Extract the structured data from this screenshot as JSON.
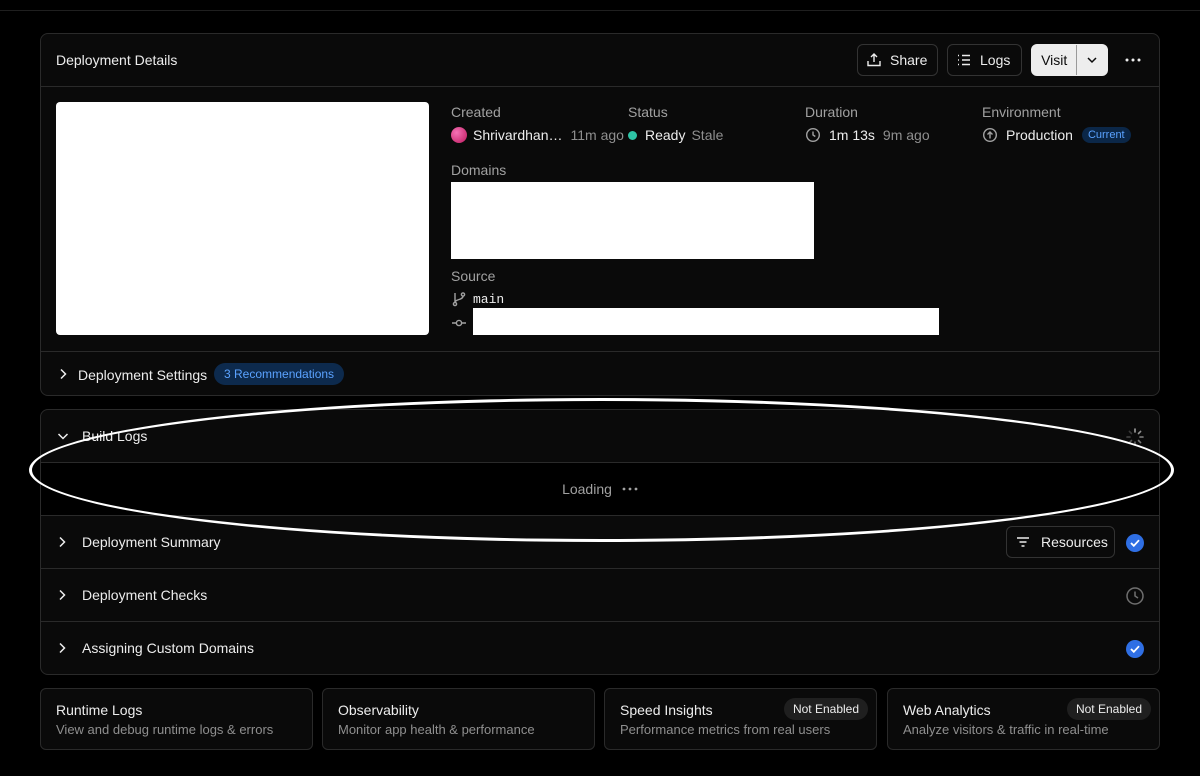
{
  "header": {
    "title": "Deployment Details",
    "share_label": "Share",
    "logs_label": "Logs",
    "visit_label": "Visit"
  },
  "info": {
    "created_label": "Created",
    "created_user": "Shrivardhan…",
    "created_ago": "11m ago",
    "status_label": "Status",
    "status_value": "Ready",
    "status_sub": "Stale",
    "duration_label": "Duration",
    "duration_value": "1m 13s",
    "duration_ago": "9m ago",
    "environment_label": "Environment",
    "environment_value": "Production",
    "environment_badge": "Current",
    "domains_label": "Domains",
    "source_label": "Source",
    "branch": "main"
  },
  "settings": {
    "label": "Deployment Settings",
    "badge": "3 Recommendations"
  },
  "sections": {
    "build_logs": "Build Logs",
    "loading": "Loading",
    "summary": "Deployment Summary",
    "resources_label": "Resources",
    "checks": "Deployment Checks",
    "custom_domains": "Assigning Custom Domains"
  },
  "tiles": [
    {
      "title": "Runtime Logs",
      "desc": "View and debug runtime logs & errors",
      "badge": ""
    },
    {
      "title": "Observability",
      "desc": "Monitor app health & performance",
      "badge": ""
    },
    {
      "title": "Speed Insights",
      "desc": "Performance metrics from real users",
      "badge": "Not Enabled"
    },
    {
      "title": "Web Analytics",
      "desc": "Analyze visitors & traffic in real-time",
      "badge": "Not Enabled"
    }
  ],
  "colors": {
    "background": "#000000",
    "card": "#0a0a0a",
    "ready_dot": "#2ec4a6",
    "accent_blue": "#2f6fe4"
  }
}
